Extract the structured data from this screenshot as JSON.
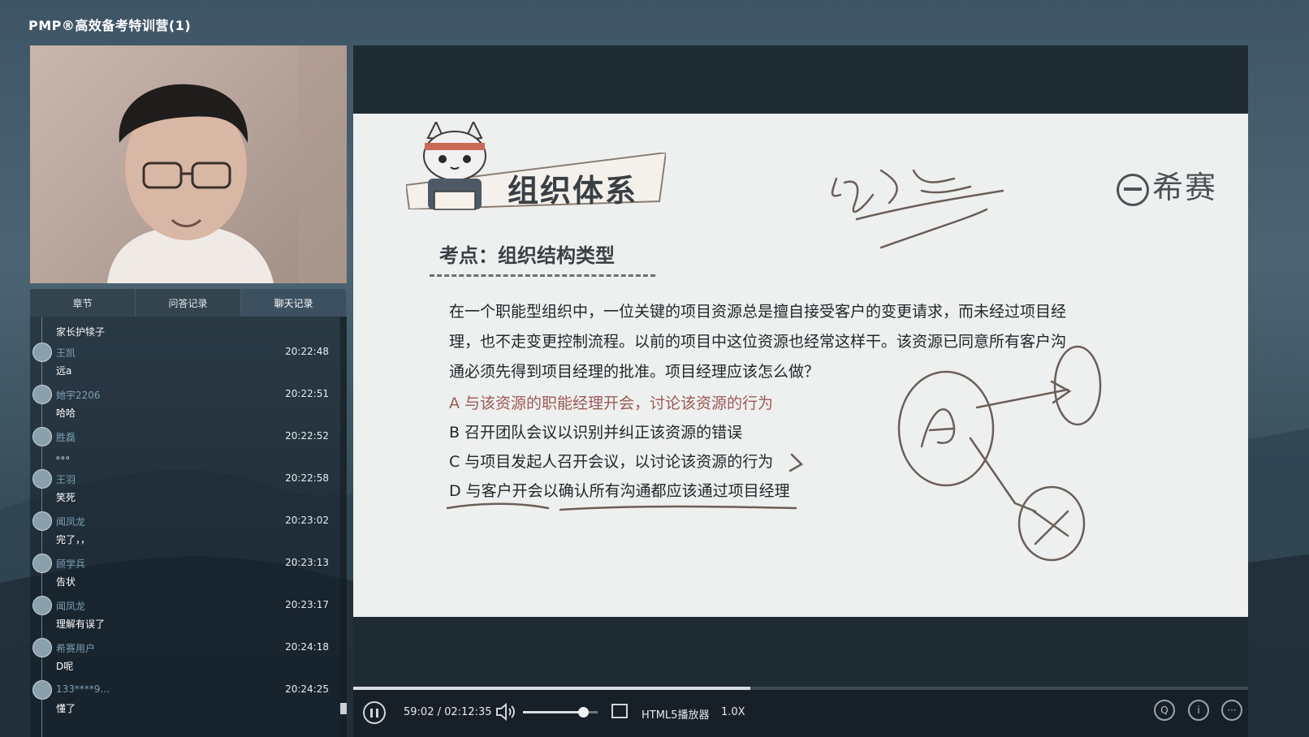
{
  "app": {
    "title": "PMP®高效备考特训营(1)"
  },
  "tabs": [
    {
      "label": "章节",
      "active": false
    },
    {
      "label": "问答记录",
      "active": false
    },
    {
      "label": "聊天记录",
      "active": true
    }
  ],
  "chat": {
    "first_message": "家长护犊子",
    "messages": [
      {
        "user": "王凯",
        "time": "20:22:48",
        "text": "远a"
      },
      {
        "user": "她宇2206",
        "time": "20:22:51",
        "text": "哈哈"
      },
      {
        "user": "胜磊",
        "time": "20:22:52",
        "text": "。。。"
      },
      {
        "user": "王羽",
        "time": "20:22:58",
        "text": "笑死"
      },
      {
        "user": "闻凤龙",
        "time": "20:23:02",
        "text": "完了，，"
      },
      {
        "user": "顾学兵",
        "time": "20:23:13",
        "text": "告状"
      },
      {
        "user": "闻凤龙",
        "time": "20:23:17",
        "text": "理解有误了"
      },
      {
        "user": "希赛用户",
        "time": "20:24:18",
        "text": "D呢"
      },
      {
        "user": "133****9...",
        "time": "20:24:25",
        "text": "懂了"
      }
    ]
  },
  "slide": {
    "title": "组织体系",
    "brand": "希赛",
    "kaodian": "考点：组织结构类型",
    "question": "在一个职能型组织中，一位关键的项目资源总是擅自接受客户的变更请求，而未经过项目经理，也不走变更控制流程。以前的项目中这位资源也经常这样干。该资源已同意所有客户沟通必须先得到项目经理的批准。项目经理应该怎么做？",
    "options": [
      "A 与该资源的职能经理开会，讨论该资源的行为",
      "B 召开团队会议以识别并纠正该资源的错误",
      "C 与项目发起人召开会议，以讨论该资源的行为",
      "D 与客户开会以确认所有沟通都应该通过项目经理"
    ]
  },
  "player": {
    "time": "59:02 / 02:12:35",
    "progress": 0.4434,
    "volume": 0.8,
    "name": "HTML5播放器",
    "speed": "1.0X",
    "icons": [
      "pause-icon",
      "volume-icon",
      "pip-icon",
      "q-icon",
      "info-icon",
      "more-icon"
    ]
  }
}
